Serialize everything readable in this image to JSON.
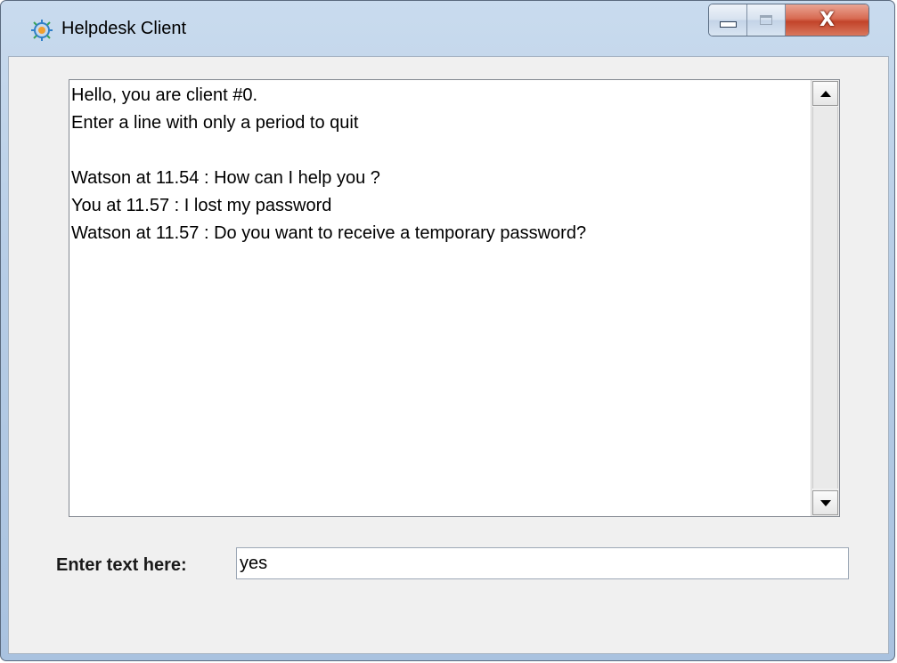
{
  "window": {
    "title": "Helpdesk Client",
    "icon": "helpdesk-app-icon",
    "controls": {
      "minimize": "minimize-icon",
      "maximize": "maximize-icon",
      "close": "close-icon"
    },
    "close_glyph": "X"
  },
  "chat": {
    "lines": [
      "Hello, you are client #0.",
      "Enter a line with only a period to quit",
      "",
      "Watson at 11.54 : How can I help you ?",
      "You at 11.57 : I lost my password",
      "Watson at 11.57 : Do you want to receive a temporary password?"
    ]
  },
  "input": {
    "label": "Enter text here:",
    "value": "yes"
  },
  "colors": {
    "close_button": "#c9472c",
    "panel_background": "#f0f0f0",
    "frame": "#b7cde6"
  }
}
